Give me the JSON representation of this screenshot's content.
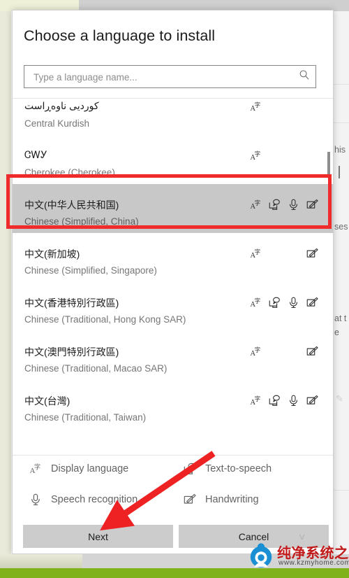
{
  "dialog": {
    "title": "Choose a language to install",
    "search": {
      "placeholder": "Type a language name...",
      "value": "",
      "icon": "search-icon"
    }
  },
  "languages": [
    {
      "native": "کوردیی ناوەڕاست",
      "english": "Central Kurdish",
      "features": [
        "display",
        "handwriting-empty"
      ],
      "selected": false,
      "partial": true
    },
    {
      "native": "ᏣᎳᎩ",
      "english": "Cherokee (Cherokee)",
      "features": [
        "display"
      ],
      "selected": false,
      "partial": false
    },
    {
      "native": "中文(中华人民共和国)",
      "english": "Chinese (Simplified, China)",
      "features": [
        "display",
        "tts",
        "speech",
        "handwriting"
      ],
      "selected": true,
      "partial": false
    },
    {
      "native": "中文(新加坡)",
      "english": "Chinese (Simplified, Singapore)",
      "features": [
        "display",
        "handwriting"
      ],
      "selected": false,
      "partial": false
    },
    {
      "native": "中文(香港特別行政區)",
      "english": "Chinese (Traditional, Hong Kong SAR)",
      "features": [
        "display",
        "tts",
        "speech",
        "handwriting"
      ],
      "selected": false,
      "partial": false
    },
    {
      "native": "中文(澳門特別行政區)",
      "english": "Chinese (Traditional, Macao SAR)",
      "features": [
        "display",
        "handwriting"
      ],
      "selected": false,
      "partial": false
    },
    {
      "native": "中文(台灣)",
      "english": "Chinese (Traditional, Taiwan)",
      "features": [
        "display",
        "tts",
        "speech",
        "handwriting"
      ],
      "selected": false,
      "partial": false
    }
  ],
  "legend": [
    {
      "icon": "display-language-icon",
      "label": "Display language"
    },
    {
      "icon": "text-to-speech-icon",
      "label": "Text-to-speech"
    },
    {
      "icon": "speech-recognition-icon",
      "label": "Speech recognition"
    },
    {
      "icon": "handwriting-icon",
      "label": "Handwriting"
    }
  ],
  "buttons": {
    "next": "Next",
    "cancel": "Cancel"
  },
  "background": {
    "text_fragments": [
      "his",
      "ses",
      "at t",
      "e"
    ]
  },
  "annotations": {
    "highlight_color": "#ef2b2b",
    "arrow_color": "#ee2222",
    "arrow_target": "Next",
    "arrow_origin": "Text-to-speech"
  },
  "watermark": {
    "brand": "纯净系统之家",
    "url": "www.kzmyhome.com"
  },
  "colors": {
    "selected_row": "#c8c8c8",
    "button_face": "#cccccc",
    "accent_green": "#7fb21b"
  }
}
